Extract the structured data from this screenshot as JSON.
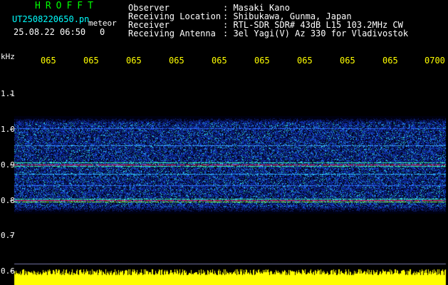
{
  "app_name": "HROFFT",
  "file_name": "UT2508220650.pn",
  "file_type": "meteor",
  "date_time": "25.08.22 06:50",
  "count": "0",
  "meta": [
    {
      "label": "Observer",
      "value": ": Masaki Kano"
    },
    {
      "label": "Receiving Location",
      "value": ": Shibukawa, Gunma, Japan"
    },
    {
      "label": "Receiver",
      "value": ": RTL-SDR SDR# 43dB L15 103.2MHz CW"
    },
    {
      "label": "Receiving Antenna",
      "value": ": 3el Yagi(V) Az 330 for Vladivostok"
    }
  ],
  "time_ticks": [
    "065",
    "065",
    "065",
    "065",
    "065",
    "065",
    "065",
    "065",
    "065",
    "0700"
  ],
  "freq_unit": "kHz",
  "freq_ticks": [
    "1.1",
    "1.0",
    "0.9",
    "0.8",
    "0.7",
    "0.6"
  ],
  "colors": {
    "background": "#000000",
    "title": "#00ff00",
    "file": "#00ffff",
    "axis_time": "#ffff00",
    "signal_band": "#ff3366",
    "noise_floor": "#ffff00"
  }
}
